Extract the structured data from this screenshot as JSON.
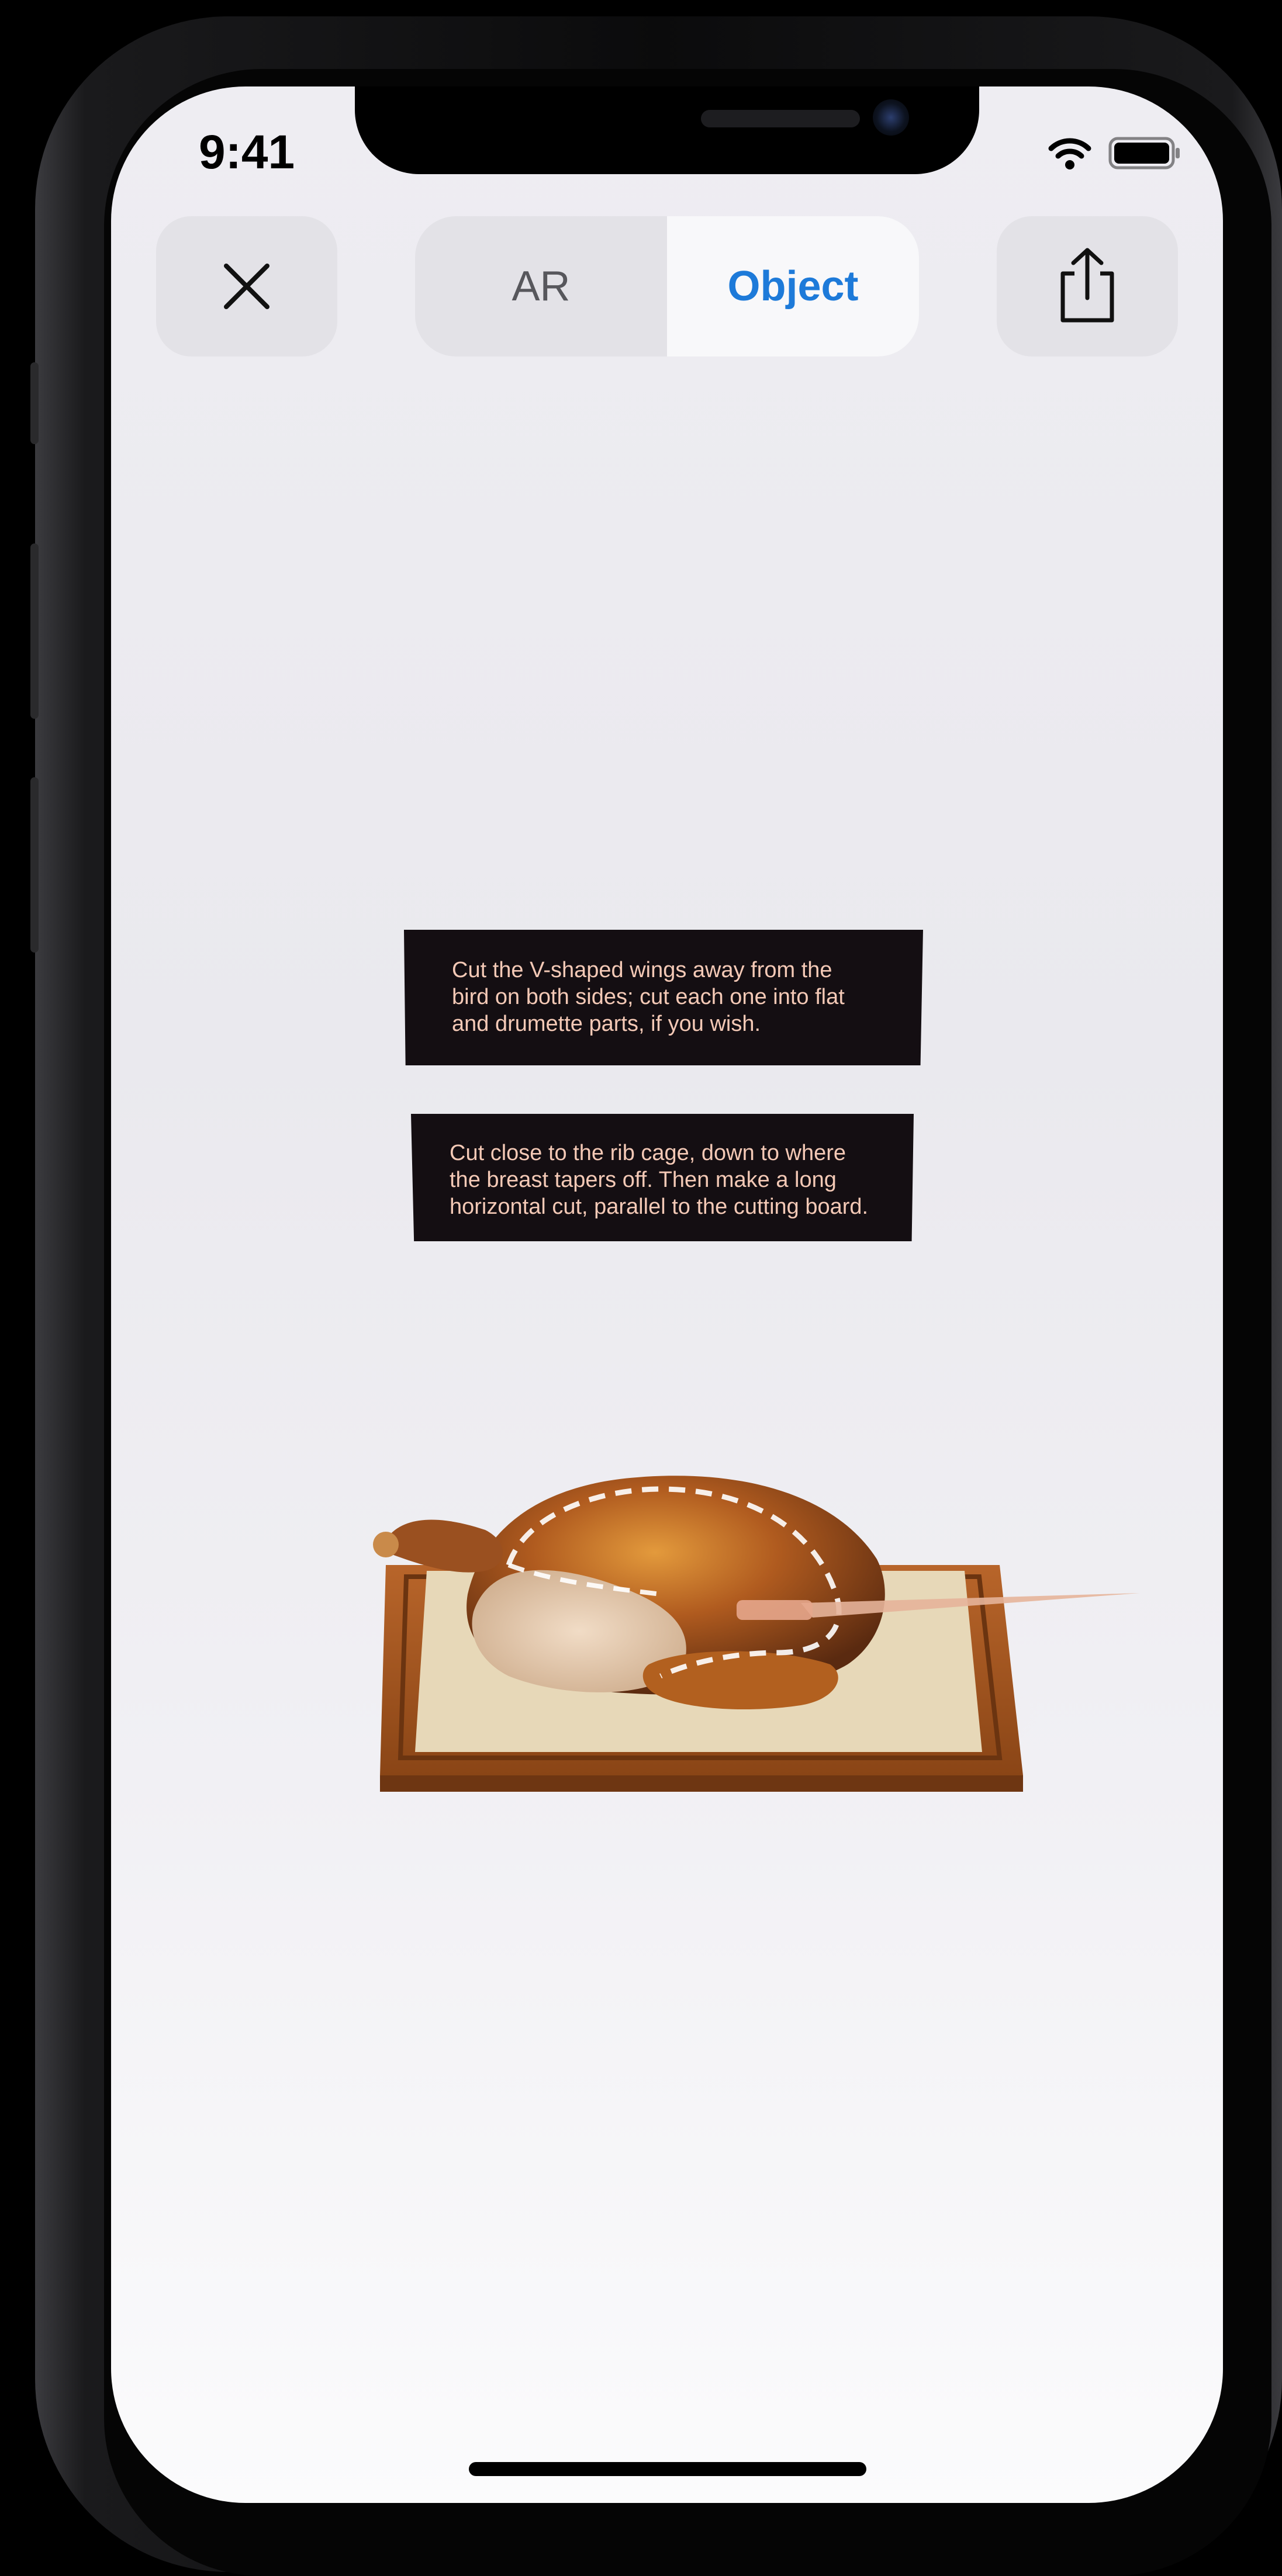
{
  "status_bar": {
    "time": "9:41",
    "icons": [
      "wifi-icon",
      "battery-icon"
    ]
  },
  "toolbar": {
    "close_icon": "close-icon",
    "segments": [
      {
        "label": "AR",
        "selected": false
      },
      {
        "label": "Object",
        "selected": true
      }
    ],
    "share_icon": "share-icon"
  },
  "instructions": [
    {
      "lines": [
        "Cut the V-shaped wings away from the",
        "bird on both sides; cut each one into flat",
        "and drumette parts, if you wish."
      ]
    },
    {
      "lines": [
        "Cut close to the rib cage, down to where",
        "the breast tapers off. Then make a long",
        "horizontal cut, parallel to the cutting board."
      ]
    }
  ],
  "colors": {
    "accent": "#1d7ad9",
    "card_background": "#140e12",
    "card_text": "#f4c9b6"
  }
}
